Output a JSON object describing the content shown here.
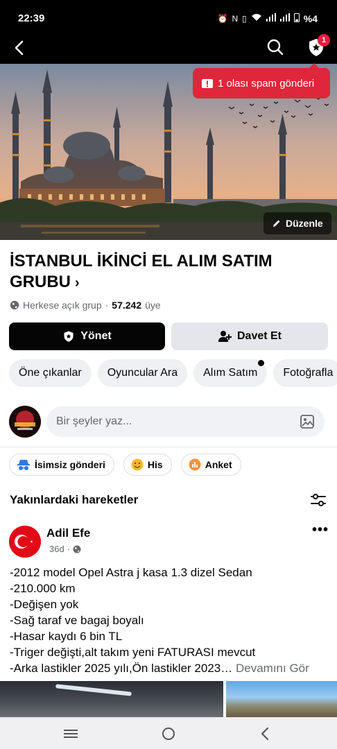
{
  "status_bar": {
    "time": "22:39",
    "battery": "%4",
    "icons": [
      "alarm-icon",
      "nfc-icon",
      "vibrate-icon",
      "volte-icon",
      "wifi-icon",
      "signal-icon",
      "signal-icon",
      "battery-icon"
    ]
  },
  "top_nav": {
    "notification_count": "1"
  },
  "cover": {
    "spam_tooltip": "1 olası spam gönderi",
    "edit_label": "Düzenle"
  },
  "group": {
    "title": "İSTANBUL İKİNCİ EL ALIM SATIM GRUBU",
    "privacy": "Herkese açık grup",
    "separator": "·",
    "member_count": "57.242",
    "member_label": "üye"
  },
  "actions": {
    "manage_label": "Yönet",
    "invite_label": "Davet Et"
  },
  "tabs": [
    {
      "label": "Öne çıkanlar"
    },
    {
      "label": "Oyuncular Ara"
    },
    {
      "label": "Alım Satım"
    },
    {
      "label": "Fotoğrafla"
    }
  ],
  "composer": {
    "placeholder": "Bir şeyler yaz..."
  },
  "post_types": [
    {
      "label": "İsimsiz gönderi",
      "icon": "anonymous-icon"
    },
    {
      "label": "His",
      "icon": "smiley-icon"
    },
    {
      "label": "Anket",
      "icon": "poll-icon"
    }
  ],
  "section": {
    "title": "Yakınlardaki hareketler"
  },
  "post": {
    "author": "Adil Efe",
    "time": "36d",
    "lines": [
      "-2012 model Opel Astra j kasa 1.3 dizel Sedan",
      "-210.000 km",
      "-Değişen yok",
      "-Sağ taraf ve bagaj boyalı",
      "-Hasar kaydı 6 bin TL",
      "-Triger değişti,alt takım yeni FATURASI mevcut",
      "-Arka lastikler 2025 yılı,Ön lastikler 2023…"
    ],
    "see_more": "Devamını Gör"
  },
  "colors": {
    "spam_red": "#e0263a",
    "badge_red": "#e41e3f",
    "primary_dark": "#050505",
    "secondary_bg": "#e4e6eb"
  }
}
